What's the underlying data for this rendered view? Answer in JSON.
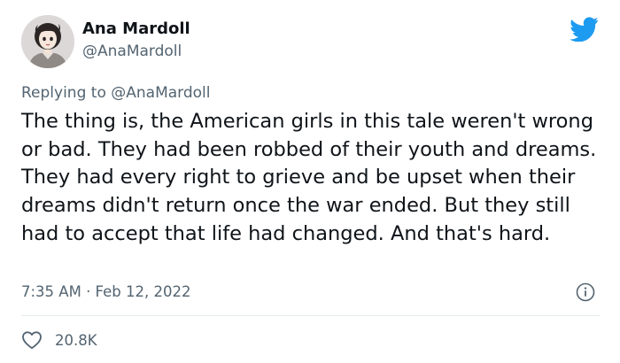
{
  "author": {
    "name": "Ana Mardoll",
    "handle": "@AnaMardoll",
    "avatar_icon": "avatar-illustration"
  },
  "platform_icon": "twitter-bird-icon",
  "brand_color": "#1d9bf0",
  "reply": {
    "prefix": "Replying to ",
    "mention": "@AnaMardoll"
  },
  "tweet": {
    "text": "The thing is, the American girls in this tale weren't wrong or bad. They had been robbed of their youth and dreams. They had every right to grieve and be upset when their dreams didn't return once the war ended. But they still had to accept that life had changed. And that's hard.",
    "timestamp": "7:35 AM · Feb 12, 2022"
  },
  "actions": {
    "like_icon": "heart-icon",
    "like_count": "20.8K",
    "info_icon": "info-icon"
  }
}
